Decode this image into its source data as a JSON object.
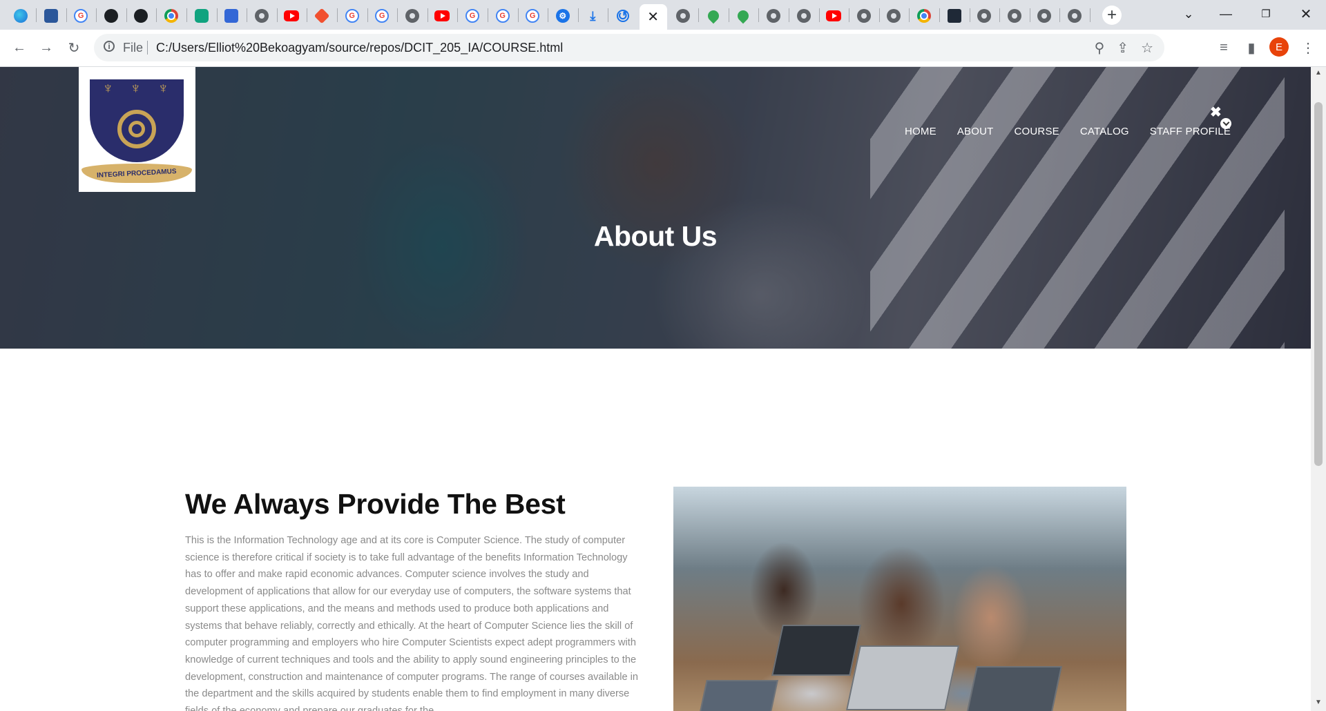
{
  "browser": {
    "tabs": [
      {
        "icon": "edge-icon"
      },
      {
        "icon": "bookmark-icon"
      },
      {
        "icon": "google-icon"
      },
      {
        "icon": "github-icon"
      },
      {
        "icon": "github-icon"
      },
      {
        "icon": "chrome-icon"
      },
      {
        "icon": "chatgpt-icon"
      },
      {
        "icon": "class-icon"
      },
      {
        "icon": "globe-icon"
      },
      {
        "icon": "youtube-icon"
      },
      {
        "icon": "git-icon"
      },
      {
        "icon": "google-icon"
      },
      {
        "icon": "google-icon"
      },
      {
        "icon": "globe-icon"
      },
      {
        "icon": "youtube-icon"
      },
      {
        "icon": "google-icon"
      },
      {
        "icon": "google-icon"
      },
      {
        "icon": "google-icon"
      },
      {
        "icon": "settings-icon"
      },
      {
        "icon": "download-icon"
      },
      {
        "icon": "history-icon"
      },
      {
        "icon": "active-tab",
        "active": true
      },
      {
        "icon": "globe-icon"
      },
      {
        "icon": "maps-icon"
      },
      {
        "icon": "maps-icon"
      },
      {
        "icon": "globe-icon"
      },
      {
        "icon": "globe-icon"
      },
      {
        "icon": "youtube-icon"
      },
      {
        "icon": "globe-icon"
      },
      {
        "icon": "globe-icon"
      },
      {
        "icon": "chrome-icon"
      },
      {
        "icon": "lens-icon"
      },
      {
        "icon": "globe-icon"
      },
      {
        "icon": "globe-icon"
      },
      {
        "icon": "globe-icon"
      },
      {
        "icon": "globe-icon"
      }
    ],
    "address": {
      "scheme_label": "File",
      "url": "C:/Users/Elliot%20Bekoagyam/source/repos/DCIT_205_IA/COURSE.html"
    },
    "profile_initial": "E"
  },
  "page": {
    "logo_motto": "INTEGRI PROCEDAMUS",
    "nav": {
      "items": [
        "HOME",
        "ABOUT",
        "COURSE",
        "CATALOG",
        "STAFF PROFILE"
      ]
    },
    "hero_title": "About Us",
    "about": {
      "heading": "We Always Provide The Best",
      "body": "This is the Information Technology age and at its core is Computer Science. The study of computer science is therefore critical if society is to take full advantage of the benefits Information Technology has to offer and make rapid economic advances. Computer science involves the study and development of applications that allow for our everyday use of computers, the software systems that support these applications, and the means and methods used to produce both applications and systems that behave reliably, correctly and ethically. At the heart of Computer Science lies the skill of computer programming and employers who hire Computer Scientists expect adept programmers with knowledge of current techniques and tools and the ability to apply sound engineering principles to the development, construction and maintenance of computer programs. The range of courses available in the department and the skills acquired by students enable them to find employment in many diverse fields of the economy and prepare our graduates for the"
    }
  }
}
